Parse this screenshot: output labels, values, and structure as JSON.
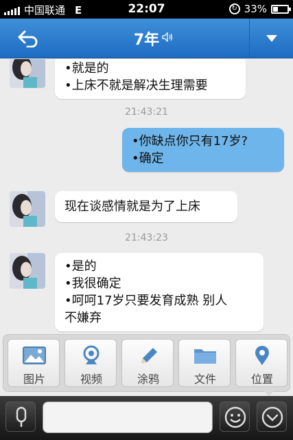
{
  "status_bar": {
    "carrier": "中国联通",
    "network": "E",
    "time": "22:07",
    "battery": "33%",
    "battery_level": 0.33
  },
  "nav": {
    "title": "7年",
    "back_icon": "back-arrow-icon",
    "menu_icon": "dropdown-triangle-icon"
  },
  "messages": [
    {
      "side": "left",
      "lines": [
        "•就是的",
        "•上床不就是解决生理需要"
      ]
    },
    {
      "timestamp": "21:43:21"
    },
    {
      "side": "right",
      "lines": [
        "•你缺点你只有17岁?",
        "•确定"
      ]
    },
    {
      "side": "left",
      "lines": [
        "现在谈感情就是为了上床"
      ]
    },
    {
      "timestamp": "21:43:23"
    },
    {
      "side": "left",
      "lines": [
        "•是的",
        "•我很确定",
        "•呵呵17岁只要发育成熟 别人",
        "不嫌弃"
      ]
    }
  ],
  "attach_tools": [
    {
      "label": "图片",
      "icon": "image-icon"
    },
    {
      "label": "视频",
      "icon": "webcam-icon"
    },
    {
      "label": "涂鸦",
      "icon": "pencil-icon"
    },
    {
      "label": "文件",
      "icon": "folder-icon"
    },
    {
      "label": "位置",
      "icon": "location-pin-icon"
    }
  ],
  "colors": {
    "nav_blue": "#2f7fd0",
    "my_bubble": "#6db5ea",
    "background": "#ececec"
  }
}
